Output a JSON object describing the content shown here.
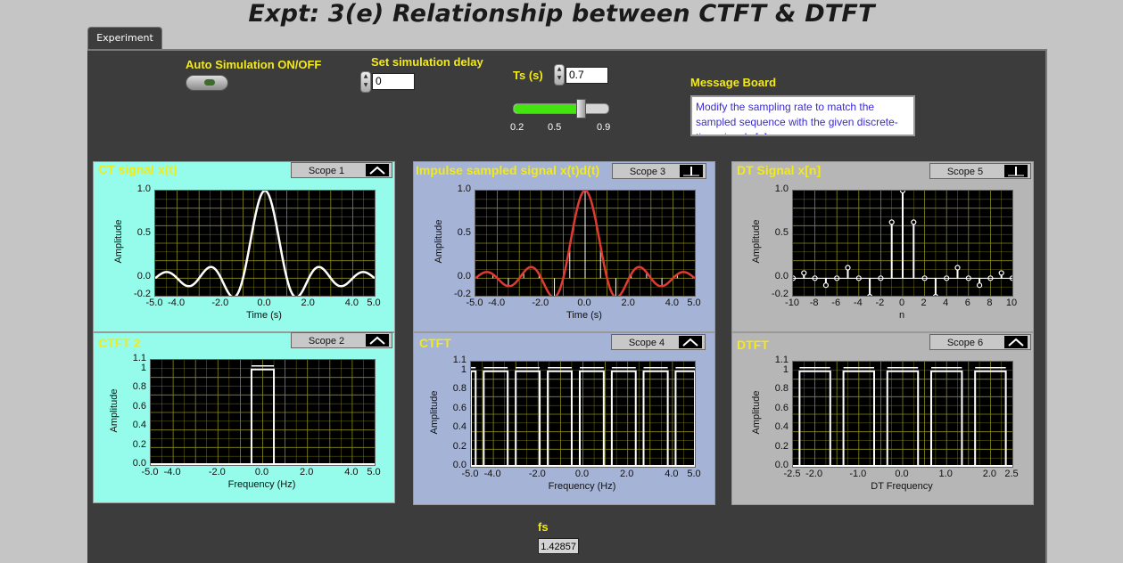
{
  "title": "Expt: 3(e) Relationship between CTFT & DTFT",
  "tab": "Experiment",
  "controls": {
    "auto_sim_label": "Auto Simulation ON/OFF",
    "delay_label": "Set simulation delay",
    "delay_value": "0",
    "ts_label": "Ts (s)",
    "ts_value": "0.7",
    "slider_ticks": [
      "0.2",
      "0.5",
      "0.9"
    ],
    "slider_level": 0.7,
    "message_label": "Message Board",
    "message_text": "Modify the sampling rate to match the sampled sequence with the given discrete-time signal x[n]",
    "fs_label": "fs",
    "fs_value": "1.42857"
  },
  "colors": {
    "cyan_panel": "#95fbea",
    "blue_panel": "#a4b3d6",
    "gray_panel": "#b6b6b6",
    "trace_white": "#ffffff",
    "trace_red": "#e03a32",
    "grid": "#8a8a1c",
    "label_yellow": "#f4ea14"
  },
  "panels": [
    {
      "title": "CT signal x(t)",
      "scope": "Scope 1",
      "icon": "expand-icon",
      "xlabel": "Time (s)",
      "ylabel": "Amplitude"
    },
    {
      "title": "Impulse sampled signal x(t)d(t)",
      "scope": "Scope 3",
      "icon": "cursor-icon",
      "xlabel": "Time (s)",
      "ylabel": "Amplitude"
    },
    {
      "title": "DT Signal x[n]",
      "scope": "Scope 5",
      "icon": "pointer-icon",
      "xlabel": "n",
      "ylabel": "Amplitude"
    },
    {
      "title": "CTFT  2",
      "scope": "Scope 2",
      "icon": "expand-icon",
      "xlabel": "Frequency (Hz)",
      "ylabel": "Amplitude"
    },
    {
      "title": "CTFT",
      "scope": "Scope 4",
      "icon": "expand-icon",
      "xlabel": "Frequency (Hz)",
      "ylabel": "Amplitude"
    },
    {
      "title": "DTFT",
      "scope": "Scope 6",
      "icon": "expand-icon",
      "xlabel": "DT Frequency",
      "ylabel": "Amplitude"
    }
  ],
  "chart_data": [
    {
      "type": "line",
      "xlim": [
        -5,
        5
      ],
      "ylim": [
        -0.2,
        1.0
      ],
      "xticks": [
        "-5.0",
        "-4.0",
        "-2.0",
        "0.0",
        "2.0",
        "4.0",
        "5.0"
      ],
      "xtick_vals": [
        -5,
        -4,
        -2,
        0,
        2,
        4,
        5
      ],
      "yticks": [
        "1.0",
        "0.5",
        "0.0",
        "-0.2"
      ],
      "ytick_vals": [
        1,
        0.5,
        0,
        -0.2
      ],
      "series": [
        {
          "kind": "sinc",
          "color": "#ffffff"
        }
      ]
    },
    {
      "type": "line",
      "xlim": [
        -5,
        5
      ],
      "ylim": [
        -0.2,
        1.0
      ],
      "xticks": [
        "-5.0",
        "-4.0",
        "-2.0",
        "0.0",
        "2.0",
        "4.0",
        "5.0"
      ],
      "xtick_vals": [
        -5,
        -4,
        -2,
        0,
        2,
        4,
        5
      ],
      "yticks": [
        "1.0",
        "0.5",
        "0.0",
        "-0.2"
      ],
      "ytick_vals": [
        1,
        0.5,
        0,
        -0.2
      ],
      "series": [
        {
          "kind": "sinc",
          "color": "#e03a32"
        }
      ],
      "impulses_at": [
        -4.9,
        -4.2,
        -3.5,
        -2.8,
        -2.1,
        -1.4,
        -0.7,
        0,
        0.7,
        1.4,
        2.1,
        2.8,
        3.5,
        4.2,
        4.9
      ]
    },
    {
      "type": "scatter",
      "xlim": [
        -10,
        10
      ],
      "ylim": [
        -0.2,
        1.0
      ],
      "xticks": [
        "-10",
        "-8",
        "-6",
        "-4",
        "-2",
        "0",
        "2",
        "4",
        "6",
        "8",
        "10"
      ],
      "xtick_vals": [
        -10,
        -8,
        -6,
        -4,
        -2,
        0,
        2,
        4,
        6,
        8,
        10
      ],
      "yticks": [
        "1.0",
        "0.5",
        "0.0",
        "-0.2"
      ],
      "ytick_vals": [
        1,
        0.5,
        0,
        -0.2
      ],
      "x": [
        -10,
        -9,
        -8,
        -7,
        -6,
        -5,
        -4,
        -3,
        -2,
        -1,
        0,
        1,
        2,
        3,
        4,
        5,
        6,
        7,
        8,
        9,
        10
      ],
      "y": [
        0,
        0.06,
        0,
        -0.08,
        0,
        0.12,
        0,
        -0.21,
        0,
        0.64,
        1.0,
        0.64,
        0,
        -0.21,
        0,
        0.12,
        0,
        -0.08,
        0,
        0.06,
        0
      ]
    },
    {
      "type": "line",
      "xlim": [
        -5,
        5
      ],
      "ylim": [
        0,
        1.1
      ],
      "xticks": [
        "-5.0",
        "-4.0",
        "-2.0",
        "0.0",
        "2.0",
        "4.0",
        "5.0"
      ],
      "xtick_vals": [
        -5,
        -4,
        -2,
        0,
        2,
        4,
        5
      ],
      "yticks": [
        "1.1",
        "1",
        "0.8",
        "0.6",
        "0.4",
        "0.2",
        "0.0"
      ],
      "ytick_vals": [
        1.1,
        1,
        0.8,
        0.6,
        0.4,
        0.2,
        0
      ],
      "rects": [
        [
          -0.5,
          0.5
        ]
      ],
      "rect_height": 1.0
    },
    {
      "type": "line",
      "xlim": [
        -5,
        5
      ],
      "ylim": [
        0,
        1.1
      ],
      "xticks": [
        "-5.0",
        "-4.0",
        "-2.0",
        "0.0",
        "2.0",
        "4.0",
        "5.0"
      ],
      "xtick_vals": [
        -5,
        -4,
        -2,
        0,
        2,
        4,
        5
      ],
      "yticks": [
        "1.1",
        "1",
        "0.8",
        "0.6",
        "0.4",
        "0.2",
        "0.0"
      ],
      "ytick_vals": [
        1.1,
        1,
        0.8,
        0.6,
        0.4,
        0.2,
        0
      ],
      "rects": [
        [
          -5,
          -4.79
        ],
        [
          -4.43,
          -3.36
        ],
        [
          -3.0,
          -1.93
        ],
        [
          -1.57,
          -0.5
        ],
        [
          -0.14,
          0.93
        ],
        [
          1.29,
          2.36
        ],
        [
          2.71,
          3.79
        ],
        [
          4.14,
          5
        ]
      ],
      "rect_height": 1.0
    },
    {
      "type": "line",
      "xlim": [
        -2.5,
        2.5
      ],
      "ylim": [
        0,
        1.1
      ],
      "xticks": [
        "-2.5",
        "-2.0",
        "-1.0",
        "0.0",
        "1.0",
        "2.0",
        "2.5"
      ],
      "xtick_vals": [
        -2.5,
        -2,
        -1,
        0,
        1,
        2,
        2.5
      ],
      "yticks": [
        "1.1",
        "1",
        "0.8",
        "0.6",
        "0.4",
        "0.2",
        "0.0"
      ],
      "ytick_vals": [
        1.1,
        1,
        0.8,
        0.6,
        0.4,
        0.2,
        0
      ],
      "rects": [
        [
          -2.35,
          -1.65
        ],
        [
          -1.35,
          -0.65
        ],
        [
          -0.35,
          0.35
        ],
        [
          0.65,
          1.35
        ],
        [
          1.65,
          2.35
        ]
      ],
      "rect_height": 1.0
    }
  ]
}
